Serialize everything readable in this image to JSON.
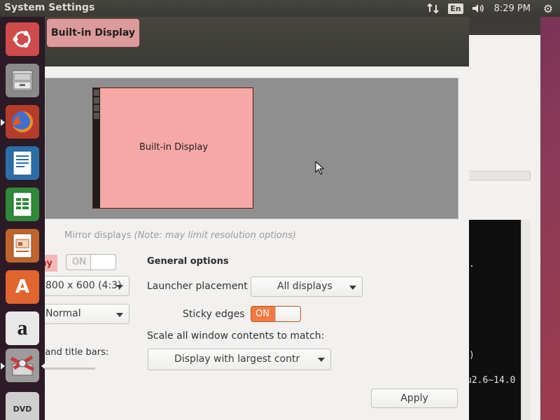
{
  "top_panel": {
    "title": "System Settings",
    "keyboard_layout": "En",
    "clock": "8:29 PM",
    "icons": [
      "network-icon",
      "volume-icon",
      "gear-icon"
    ]
  },
  "launcher": {
    "items": [
      {
        "name": "ubuntu-dash",
        "icon": "ubuntu-logo-icon"
      },
      {
        "name": "files",
        "icon": "file-cabinet-icon"
      },
      {
        "name": "firefox",
        "icon": "firefox-icon"
      },
      {
        "name": "libreoffice-writer",
        "icon": "writer-icon"
      },
      {
        "name": "libreoffice-calc",
        "icon": "calc-icon"
      },
      {
        "name": "libreoffice-impress",
        "icon": "impress-icon"
      },
      {
        "name": "ubuntu-software",
        "icon": "software-center-icon",
        "letter": "A"
      },
      {
        "name": "amazon",
        "icon": "amazon-icon",
        "letter": "a"
      },
      {
        "name": "system-settings",
        "icon": "settings-icon"
      },
      {
        "name": "dvd",
        "icon": "dvd-icon",
        "letter": "DVD"
      }
    ]
  },
  "settings_window": {
    "display_tab": "Built-in Display",
    "monitor_label": "Built-in Display",
    "mirror_label": "Mirror displays",
    "mirror_note": "(Note: may limit resolution options)",
    "display_toggle_label": "ay",
    "display_toggle_state": "ON",
    "resolution": "800 x 600 (4:3)",
    "rotation": "Normal",
    "menu_title_label": "u and title bars:",
    "general_heading": "General options",
    "launcher_placement_label": "Launcher placement",
    "launcher_placement_value": "All displays",
    "sticky_edges_label": "Sticky edges",
    "sticky_edges_state": "ON",
    "scale_label": "Scale all window contents to match:",
    "scale_value": "Display with largest contr",
    "apply_label": "Apply"
  },
  "background_window": {
    "terminal_lines": [
      ".",
      ")",
      "u2.6~14.0"
    ]
  },
  "colors": {
    "selected_display": "#f5a8a6",
    "toggle_on": "#f47a41",
    "panel": "#3c3b37",
    "launcher": "#281a24"
  }
}
